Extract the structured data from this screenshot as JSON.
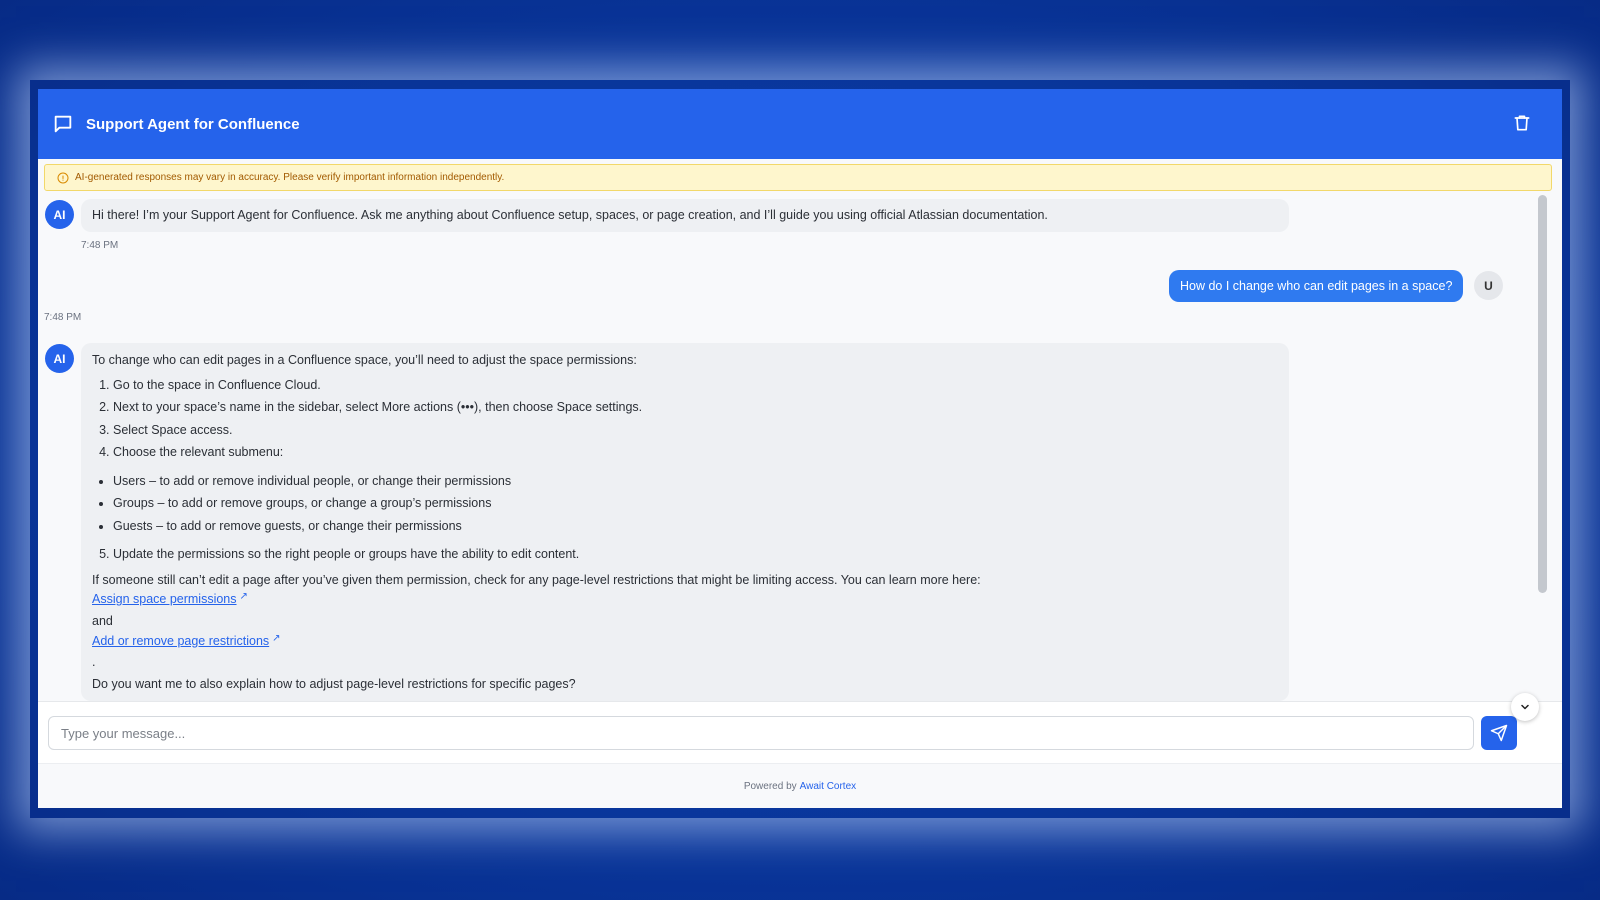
{
  "header": {
    "title": "Support Agent for Confluence",
    "icon": "chat-bubble-icon",
    "trash_icon": "trash-icon"
  },
  "banner": {
    "icon": "info-icon",
    "text": "AI-generated responses may vary in accuracy. Please verify important information independently."
  },
  "messages": {
    "greeting": {
      "avatar": "AI",
      "text": "Hi there! I’m your Support Agent for Confluence. Ask me anything about Confluence setup, spaces, or page creation, and I’ll guide you using official Atlassian documentation.",
      "time": "7:48 PM"
    },
    "user_question": {
      "avatar": "U",
      "text": "How do I change who can edit pages in a space?",
      "time": "7:48 PM"
    },
    "answer": {
      "avatar": "AI",
      "intro": "To change who can edit pages in a Confluence space, you’ll need to adjust the space permissions:",
      "steps": [
        "Go to the space in Confluence Cloud.",
        "Next to your space’s name in the sidebar, select More actions (•••), then choose Space settings.",
        "Select Space access.",
        "Choose the relevant submenu:"
      ],
      "bullets": [
        "Users – to add or remove individual people, or change their permissions",
        "Groups – to add or remove groups, or change a group’s permissions",
        "Guests – to add or remove guests, or change their permissions"
      ],
      "step5": "Update the permissions so the right people or groups have the ability to edit content.",
      "followup": "If someone still can’t edit a page after you’ve given them permission, check for any page-level restrictions that might be limiting access. You can learn more here:",
      "link1": "Assign space permissions",
      "and_text": "and",
      "link2": "Add or remove page restrictions",
      "period": ".",
      "question": "Do you want me to also explain how to adjust page-level restrictions for specific pages?"
    }
  },
  "input": {
    "placeholder": "Type your message...",
    "value": ""
  },
  "footer": {
    "prefix": "Powered by",
    "brand": "Await Cortex"
  },
  "colors": {
    "primary": "#2563eb",
    "user_bubble": "#2f7af0",
    "banner_bg": "#fef6cd",
    "banner_text": "#a25a00"
  }
}
